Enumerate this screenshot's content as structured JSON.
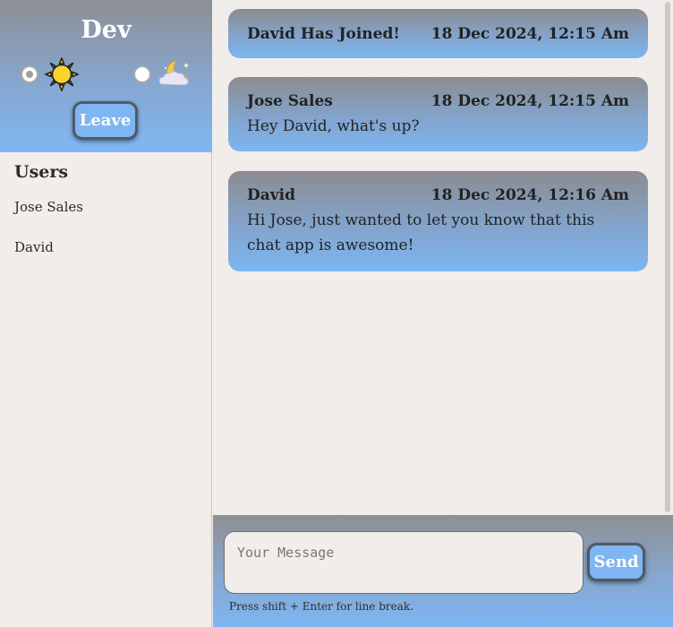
{
  "sidebar": {
    "room_name": "Dev",
    "theme": {
      "selected": "light",
      "light_icon": "sun-icon",
      "dark_icon": "moon-cloud-icon"
    },
    "leave_label": "Leave",
    "users_title": "Users",
    "users": [
      "Jose Sales",
      "David"
    ]
  },
  "messages": [
    {
      "author": "David Has Joined!",
      "time": "18 Dec 2024, 12:15 Am",
      "text": ""
    },
    {
      "author": "Jose Sales",
      "time": "18 Dec 2024, 12:15 Am",
      "text": "Hey David, what's up?"
    },
    {
      "author": "David",
      "time": "18 Dec 2024, 12:16 Am",
      "text": "Hi Jose, just wanted to let you know that this chat app is awesome!"
    }
  ],
  "composer": {
    "placeholder": "Your Message",
    "value": "",
    "send_label": "Send",
    "hint": "Press shift + Enter for line break."
  },
  "colors": {
    "accent": "#7fb5f2",
    "background": "#f1edeb",
    "gradient_top": "#8d8f95",
    "gradient_bottom": "#7fb7f3"
  }
}
